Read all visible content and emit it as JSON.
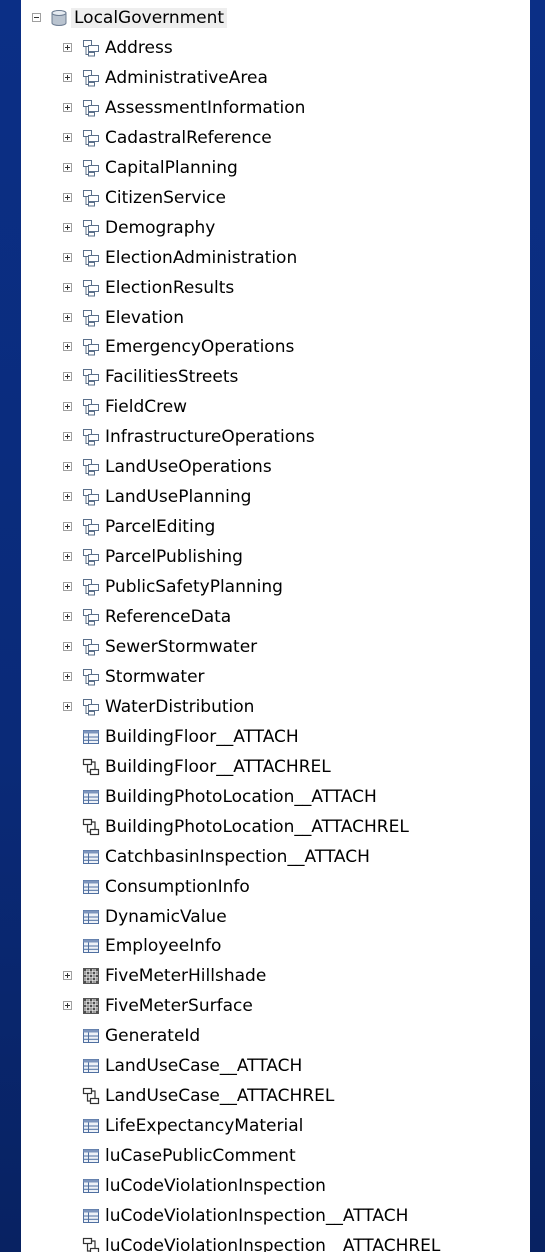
{
  "tree": {
    "root": {
      "label": "LocalGovernment",
      "icon": "database-icon",
      "expanded": true
    },
    "items": [
      {
        "label": "Address",
        "icon": "feature-dataset-icon",
        "expandable": true
      },
      {
        "label": "AdministrativeArea",
        "icon": "feature-dataset-icon",
        "expandable": true
      },
      {
        "label": "AssessmentInformation",
        "icon": "feature-dataset-icon",
        "expandable": true
      },
      {
        "label": "CadastralReference",
        "icon": "feature-dataset-icon",
        "expandable": true
      },
      {
        "label": "CapitalPlanning",
        "icon": "feature-dataset-icon",
        "expandable": true
      },
      {
        "label": "CitizenService",
        "icon": "feature-dataset-icon",
        "expandable": true
      },
      {
        "label": "Demography",
        "icon": "feature-dataset-icon",
        "expandable": true
      },
      {
        "label": "ElectionAdministration",
        "icon": "feature-dataset-icon",
        "expandable": true
      },
      {
        "label": "ElectionResults",
        "icon": "feature-dataset-icon",
        "expandable": true
      },
      {
        "label": "Elevation",
        "icon": "feature-dataset-icon",
        "expandable": true
      },
      {
        "label": "EmergencyOperations",
        "icon": "feature-dataset-icon",
        "expandable": true
      },
      {
        "label": "FacilitiesStreets",
        "icon": "feature-dataset-icon",
        "expandable": true
      },
      {
        "label": "FieldCrew",
        "icon": "feature-dataset-icon",
        "expandable": true
      },
      {
        "label": "InfrastructureOperations",
        "icon": "feature-dataset-icon",
        "expandable": true
      },
      {
        "label": "LandUseOperations",
        "icon": "feature-dataset-icon",
        "expandable": true
      },
      {
        "label": "LandUsePlanning",
        "icon": "feature-dataset-icon",
        "expandable": true
      },
      {
        "label": "ParcelEditing",
        "icon": "feature-dataset-icon",
        "expandable": true
      },
      {
        "label": "ParcelPublishing",
        "icon": "feature-dataset-icon",
        "expandable": true
      },
      {
        "label": "PublicSafetyPlanning",
        "icon": "feature-dataset-icon",
        "expandable": true
      },
      {
        "label": "ReferenceData",
        "icon": "feature-dataset-icon",
        "expandable": true
      },
      {
        "label": "SewerStormwater",
        "icon": "feature-dataset-icon",
        "expandable": true
      },
      {
        "label": "Stormwater",
        "icon": "feature-dataset-icon",
        "expandable": true
      },
      {
        "label": "WaterDistribution",
        "icon": "feature-dataset-icon",
        "expandable": true
      },
      {
        "label": "BuildingFloor__ATTACH",
        "icon": "table-icon",
        "expandable": false
      },
      {
        "label": "BuildingFloor__ATTACHREL",
        "icon": "relationship-class-icon",
        "expandable": false
      },
      {
        "label": "BuildingPhotoLocation__ATTACH",
        "icon": "table-icon",
        "expandable": false
      },
      {
        "label": "BuildingPhotoLocation__ATTACHREL",
        "icon": "relationship-class-icon",
        "expandable": false
      },
      {
        "label": "CatchbasinInspection__ATTACH",
        "icon": "table-icon",
        "expandable": false
      },
      {
        "label": "ConsumptionInfo",
        "icon": "table-icon",
        "expandable": false
      },
      {
        "label": "DynamicValue",
        "icon": "table-icon",
        "expandable": false
      },
      {
        "label": "EmployeeInfo",
        "icon": "table-icon",
        "expandable": false
      },
      {
        "label": "FiveMeterHillshade",
        "icon": "raster-icon",
        "expandable": true
      },
      {
        "label": "FiveMeterSurface",
        "icon": "raster-icon",
        "expandable": true
      },
      {
        "label": "GenerateId",
        "icon": "table-icon",
        "expandable": false
      },
      {
        "label": "LandUseCase__ATTACH",
        "icon": "table-icon",
        "expandable": false
      },
      {
        "label": "LandUseCase__ATTACHREL",
        "icon": "relationship-class-icon",
        "expandable": false
      },
      {
        "label": "LifeExpectancyMaterial",
        "icon": "table-icon",
        "expandable": false
      },
      {
        "label": "luCasePublicComment",
        "icon": "table-icon",
        "expandable": false
      },
      {
        "label": "luCodeViolationInspection",
        "icon": "table-icon",
        "expandable": false
      },
      {
        "label": "luCodeViolationInspection__ATTACH",
        "icon": "table-icon",
        "expandable": false
      },
      {
        "label": "luCodeViolationInspection__ATTACHREL",
        "icon": "relationship-class-icon",
        "expandable": false
      }
    ]
  },
  "colors": {
    "background": "#0a2a78",
    "panel": "#ffffff",
    "dataset_icon": "#5a6f8a",
    "table_icon": "#4f6fa0"
  }
}
